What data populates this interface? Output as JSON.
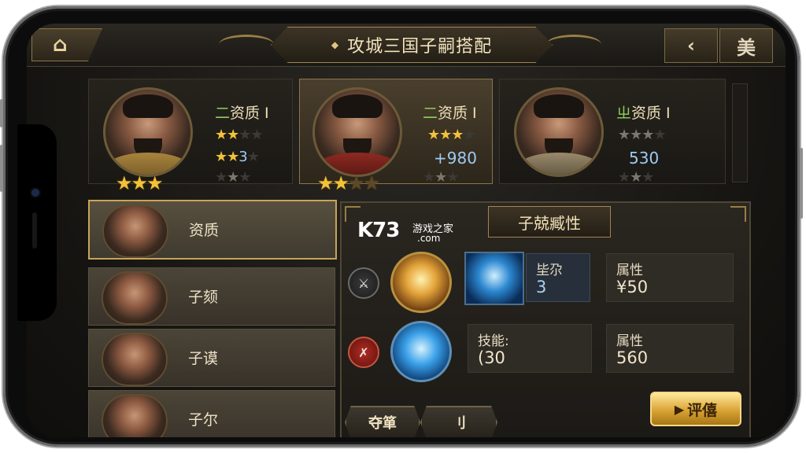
{
  "header": {
    "home_icon": "home-icon",
    "home_glyph": "⌂",
    "title": "攻城三国子嗣搭配",
    "title_marker": "◆",
    "icon_back": "‹",
    "icon_menu": "美"
  },
  "heroes": [
    {
      "name_prefix": "二",
      "name": "资质 I",
      "stars_big": "★★★",
      "row1": "★★",
      "row2": "★★",
      "row2_val": "3",
      "row3": "★"
    },
    {
      "name_prefix": "二",
      "name": "资质 I",
      "stars_big": "★★",
      "row1": "★★★",
      "row2": "",
      "row2_val": "+980",
      "row3": "★"
    },
    {
      "name_prefix": "ㄓ",
      "name": "资质 I",
      "stars_big": "",
      "row1": "★★★",
      "row2": "",
      "row2_val": "530",
      "row3": "★"
    }
  ],
  "list": [
    {
      "label": "资质"
    },
    {
      "label": "子颏"
    },
    {
      "label": "子谟"
    },
    {
      "label": "子尔"
    }
  ],
  "panel": {
    "title": "子兢臧性",
    "watermark_big": "K73",
    "watermark_small1": "游戏之家",
    "watermark_small2": ".com",
    "row1": {
      "icon1": "sword-icon",
      "box1_label": "坒尕",
      "box1_value": "3",
      "box2_label": "属性",
      "box2_value": "¥50"
    },
    "row2": {
      "icon1": "axe-icon",
      "box1_label": "技能:",
      "box1_value": "(30",
      "box2_label": "属性",
      "box2_value": "560"
    },
    "btn_left": "夺箪",
    "btn_mid": "刂",
    "btn_gold": "评僖",
    "btn_gold_icon": "▶"
  }
}
